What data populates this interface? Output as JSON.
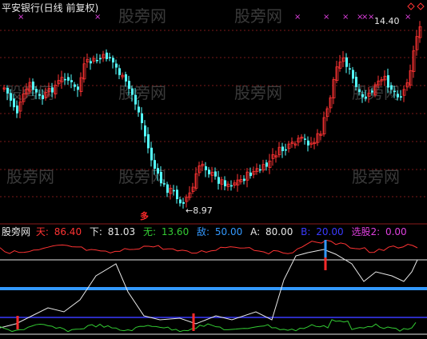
{
  "header": {
    "title": "平安银行(日线 前复权)",
    "last_price": "14.40",
    "low_price": "8.97",
    "signal_mark": "多",
    "top_marks": [
      "×",
      "×",
      "×",
      "×",
      "×",
      "×",
      "×",
      "×",
      "×"
    ]
  },
  "indicator": {
    "name": "股旁网",
    "tian_label": "天:",
    "tian_value": "86.40",
    "xia_label": "下:",
    "xia_value": "81.03",
    "wu_label": "无:",
    "wu_value": "13.60",
    "di_label": "敌:",
    "di_value": "50.00",
    "a_label": "A:",
    "a_value": "80.00",
    "b_label": "B:",
    "b_value": "20.00",
    "xg_label": "选股2:",
    "xg_value": "0.00"
  },
  "watermarks": [
    "股旁网",
    "股旁网",
    "股旁网",
    "股旁网",
    "股旁网",
    "股旁网",
    "股旁网",
    "股旁网",
    "股旁网"
  ],
  "colors": {
    "up": "#ff3333",
    "down": "#54ffff",
    "tian": "#ff3333",
    "xia": "#e8e8e8",
    "wu": "#33cc33",
    "di": "#3399ff",
    "a": "#e8e8e8",
    "b": "#3a3aff",
    "xg": "#e040e0",
    "mark": "#e040e0"
  }
}
